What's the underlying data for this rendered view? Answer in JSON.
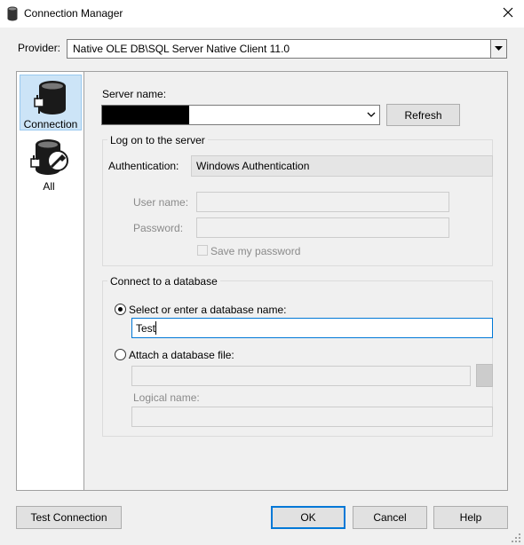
{
  "window": {
    "title": "Connection Manager"
  },
  "provider": {
    "label": "Provider:",
    "value": "Native OLE DB\\SQL Server Native Client 11.0"
  },
  "sidebar": {
    "items": [
      {
        "label": "Connection",
        "icon": "database-plug-icon"
      },
      {
        "label": "All",
        "icon": "database-wrench-icon"
      }
    ]
  },
  "server": {
    "label": "Server name:",
    "value": "",
    "refresh_label": "Refresh"
  },
  "logon": {
    "group_title": "Log on to the server",
    "auth_label": "Authentication:",
    "auth_value": "Windows Authentication",
    "username_label": "User name:",
    "password_label": "Password:",
    "save_password_label": "Save my password"
  },
  "database": {
    "group_title": "Connect to a database",
    "select_label": "Select or enter a database name:",
    "db_name_value": "Test",
    "attach_label": "Attach a database file:",
    "logical_name_label": "Logical name:"
  },
  "buttons": {
    "test_connection": "Test Connection",
    "ok": "OK",
    "cancel": "Cancel",
    "help": "Help"
  }
}
